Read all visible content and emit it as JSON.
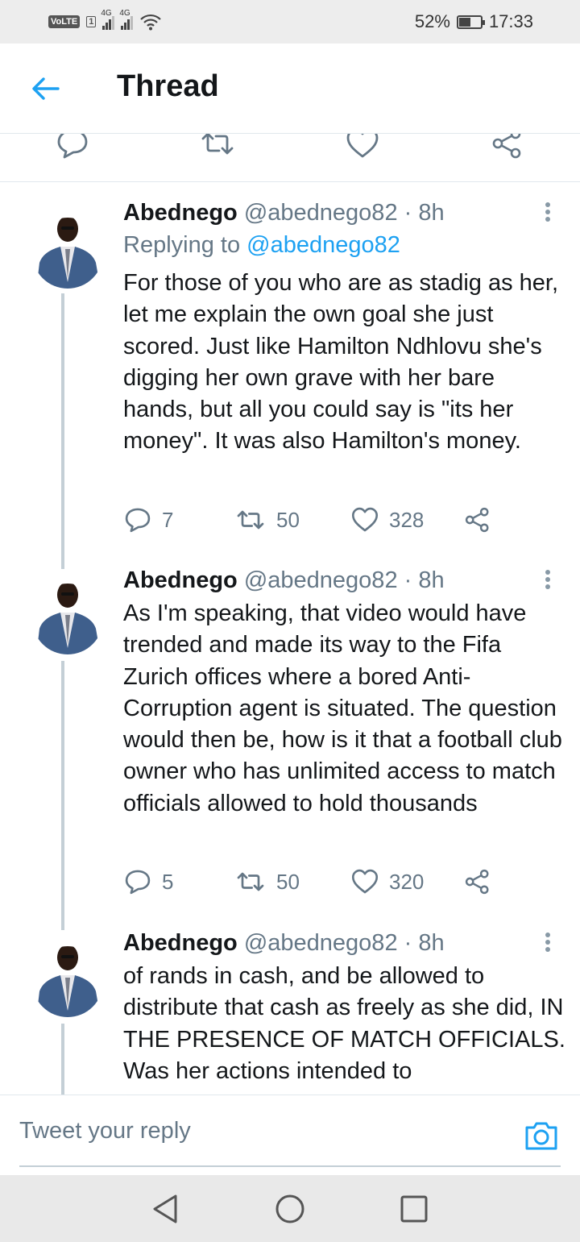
{
  "status_bar": {
    "volte": "VoLTE",
    "sim": "1",
    "network_1": "4G",
    "network_2": "4G",
    "battery_percent": "52%",
    "battery_level": 0.52,
    "time": "17:33"
  },
  "header": {
    "title": "Thread",
    "back_icon": "arrow-left-icon"
  },
  "colors": {
    "accent": "#1da1f2",
    "text_primary": "#14171a",
    "text_secondary": "#657786",
    "thread_line": "#c4cfd6"
  },
  "tweets": [
    {
      "name": "Abednego",
      "meta": "@abednego82 · 8h",
      "reply_prefix": "Replying to ",
      "reply_handle": "@abednego82",
      "text": "For those of you who are as stadig as her, let me explain the own goal she just scored. Just like Hamilton Ndhlovu she's digging her own grave with her bare hands, but all you could say is \"its her money\". It was also Hamilton's money.",
      "replies": "7",
      "retweets": "50",
      "likes": "328"
    },
    {
      "name": "Abednego",
      "meta": "@abednego82 · 8h",
      "text": "As I'm speaking, that video would have trended and made its way to the Fifa Zurich offices where a bored Anti-Corruption agent is situated. The question would then be, how is it that a football club owner who has unlimited access to match officials allowed to hold thousands",
      "replies": "5",
      "retweets": "50",
      "likes": "320"
    },
    {
      "name": "Abednego",
      "meta": "@abednego82 · 8h",
      "text": "of rands in cash, and be allowed to distribute that cash as freely as she did, IN THE PRESENCE OF MATCH OFFICIALS. Was her actions intended to"
    }
  ],
  "reply_bar": {
    "placeholder": "Tweet your reply",
    "camera_icon": "camera-icon"
  },
  "nav_bar": {
    "back": "nav-back-icon",
    "home": "nav-home-icon",
    "recents": "nav-recents-icon"
  }
}
